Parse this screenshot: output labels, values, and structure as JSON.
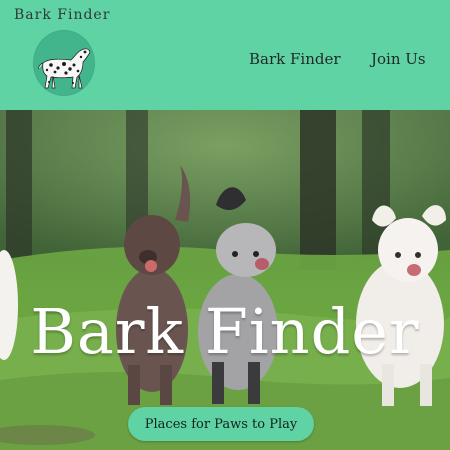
{
  "header": {
    "brand": "Bark Finder",
    "logo_icon": "dalmatian-icon",
    "nav": [
      "Bark Finder",
      "Join Us"
    ]
  },
  "hero": {
    "title": "Bark Finder",
    "cta": "Places for Paws to Play"
  },
  "colors": {
    "accent": "#5fd3a4",
    "logo_bg": "#42b58c"
  }
}
